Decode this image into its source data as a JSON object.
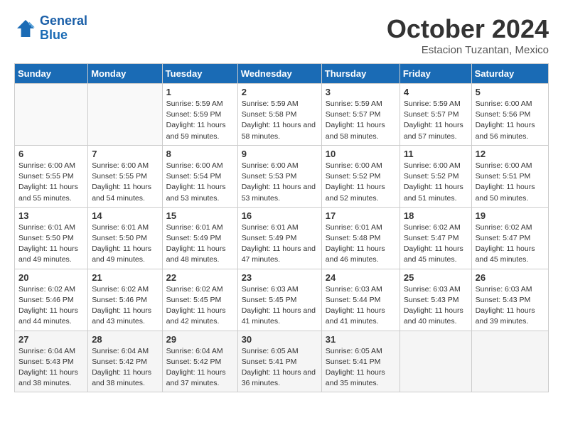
{
  "logo": {
    "line1": "General",
    "line2": "Blue"
  },
  "title": "October 2024",
  "location": "Estacion Tuzantan, Mexico",
  "headers": [
    "Sunday",
    "Monday",
    "Tuesday",
    "Wednesday",
    "Thursday",
    "Friday",
    "Saturday"
  ],
  "weeks": [
    [
      {
        "day": "",
        "sunrise": "",
        "sunset": "",
        "daylight": ""
      },
      {
        "day": "",
        "sunrise": "",
        "sunset": "",
        "daylight": ""
      },
      {
        "day": "1",
        "sunrise": "Sunrise: 5:59 AM",
        "sunset": "Sunset: 5:59 PM",
        "daylight": "Daylight: 11 hours and 59 minutes."
      },
      {
        "day": "2",
        "sunrise": "Sunrise: 5:59 AM",
        "sunset": "Sunset: 5:58 PM",
        "daylight": "Daylight: 11 hours and 58 minutes."
      },
      {
        "day": "3",
        "sunrise": "Sunrise: 5:59 AM",
        "sunset": "Sunset: 5:57 PM",
        "daylight": "Daylight: 11 hours and 58 minutes."
      },
      {
        "day": "4",
        "sunrise": "Sunrise: 5:59 AM",
        "sunset": "Sunset: 5:57 PM",
        "daylight": "Daylight: 11 hours and 57 minutes."
      },
      {
        "day": "5",
        "sunrise": "Sunrise: 6:00 AM",
        "sunset": "Sunset: 5:56 PM",
        "daylight": "Daylight: 11 hours and 56 minutes."
      }
    ],
    [
      {
        "day": "6",
        "sunrise": "Sunrise: 6:00 AM",
        "sunset": "Sunset: 5:55 PM",
        "daylight": "Daylight: 11 hours and 55 minutes."
      },
      {
        "day": "7",
        "sunrise": "Sunrise: 6:00 AM",
        "sunset": "Sunset: 5:55 PM",
        "daylight": "Daylight: 11 hours and 54 minutes."
      },
      {
        "day": "8",
        "sunrise": "Sunrise: 6:00 AM",
        "sunset": "Sunset: 5:54 PM",
        "daylight": "Daylight: 11 hours and 53 minutes."
      },
      {
        "day": "9",
        "sunrise": "Sunrise: 6:00 AM",
        "sunset": "Sunset: 5:53 PM",
        "daylight": "Daylight: 11 hours and 53 minutes."
      },
      {
        "day": "10",
        "sunrise": "Sunrise: 6:00 AM",
        "sunset": "Sunset: 5:52 PM",
        "daylight": "Daylight: 11 hours and 52 minutes."
      },
      {
        "day": "11",
        "sunrise": "Sunrise: 6:00 AM",
        "sunset": "Sunset: 5:52 PM",
        "daylight": "Daylight: 11 hours and 51 minutes."
      },
      {
        "day": "12",
        "sunrise": "Sunrise: 6:00 AM",
        "sunset": "Sunset: 5:51 PM",
        "daylight": "Daylight: 11 hours and 50 minutes."
      }
    ],
    [
      {
        "day": "13",
        "sunrise": "Sunrise: 6:01 AM",
        "sunset": "Sunset: 5:50 PM",
        "daylight": "Daylight: 11 hours and 49 minutes."
      },
      {
        "day": "14",
        "sunrise": "Sunrise: 6:01 AM",
        "sunset": "Sunset: 5:50 PM",
        "daylight": "Daylight: 11 hours and 49 minutes."
      },
      {
        "day": "15",
        "sunrise": "Sunrise: 6:01 AM",
        "sunset": "Sunset: 5:49 PM",
        "daylight": "Daylight: 11 hours and 48 minutes."
      },
      {
        "day": "16",
        "sunrise": "Sunrise: 6:01 AM",
        "sunset": "Sunset: 5:49 PM",
        "daylight": "Daylight: 11 hours and 47 minutes."
      },
      {
        "day": "17",
        "sunrise": "Sunrise: 6:01 AM",
        "sunset": "Sunset: 5:48 PM",
        "daylight": "Daylight: 11 hours and 46 minutes."
      },
      {
        "day": "18",
        "sunrise": "Sunrise: 6:02 AM",
        "sunset": "Sunset: 5:47 PM",
        "daylight": "Daylight: 11 hours and 45 minutes."
      },
      {
        "day": "19",
        "sunrise": "Sunrise: 6:02 AM",
        "sunset": "Sunset: 5:47 PM",
        "daylight": "Daylight: 11 hours and 45 minutes."
      }
    ],
    [
      {
        "day": "20",
        "sunrise": "Sunrise: 6:02 AM",
        "sunset": "Sunset: 5:46 PM",
        "daylight": "Daylight: 11 hours and 44 minutes."
      },
      {
        "day": "21",
        "sunrise": "Sunrise: 6:02 AM",
        "sunset": "Sunset: 5:46 PM",
        "daylight": "Daylight: 11 hours and 43 minutes."
      },
      {
        "day": "22",
        "sunrise": "Sunrise: 6:02 AM",
        "sunset": "Sunset: 5:45 PM",
        "daylight": "Daylight: 11 hours and 42 minutes."
      },
      {
        "day": "23",
        "sunrise": "Sunrise: 6:03 AM",
        "sunset": "Sunset: 5:45 PM",
        "daylight": "Daylight: 11 hours and 41 minutes."
      },
      {
        "day": "24",
        "sunrise": "Sunrise: 6:03 AM",
        "sunset": "Sunset: 5:44 PM",
        "daylight": "Daylight: 11 hours and 41 minutes."
      },
      {
        "day": "25",
        "sunrise": "Sunrise: 6:03 AM",
        "sunset": "Sunset: 5:43 PM",
        "daylight": "Daylight: 11 hours and 40 minutes."
      },
      {
        "day": "26",
        "sunrise": "Sunrise: 6:03 AM",
        "sunset": "Sunset: 5:43 PM",
        "daylight": "Daylight: 11 hours and 39 minutes."
      }
    ],
    [
      {
        "day": "27",
        "sunrise": "Sunrise: 6:04 AM",
        "sunset": "Sunset: 5:43 PM",
        "daylight": "Daylight: 11 hours and 38 minutes."
      },
      {
        "day": "28",
        "sunrise": "Sunrise: 6:04 AM",
        "sunset": "Sunset: 5:42 PM",
        "daylight": "Daylight: 11 hours and 38 minutes."
      },
      {
        "day": "29",
        "sunrise": "Sunrise: 6:04 AM",
        "sunset": "Sunset: 5:42 PM",
        "daylight": "Daylight: 11 hours and 37 minutes."
      },
      {
        "day": "30",
        "sunrise": "Sunrise: 6:05 AM",
        "sunset": "Sunset: 5:41 PM",
        "daylight": "Daylight: 11 hours and 36 minutes."
      },
      {
        "day": "31",
        "sunrise": "Sunrise: 6:05 AM",
        "sunset": "Sunset: 5:41 PM",
        "daylight": "Daylight: 11 hours and 35 minutes."
      },
      {
        "day": "",
        "sunrise": "",
        "sunset": "",
        "daylight": ""
      },
      {
        "day": "",
        "sunrise": "",
        "sunset": "",
        "daylight": ""
      }
    ]
  ]
}
